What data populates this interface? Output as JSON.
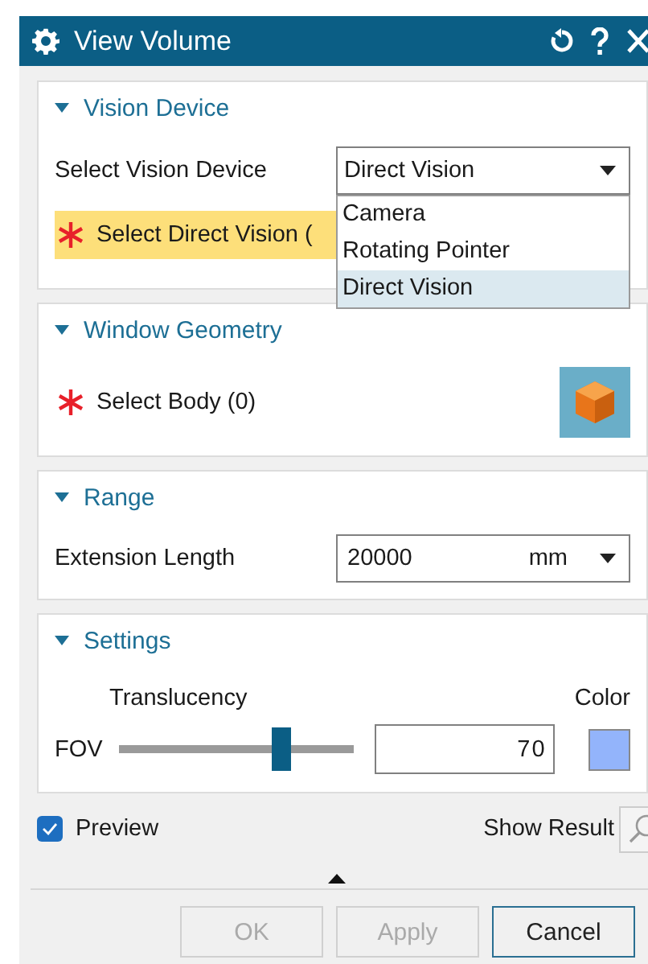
{
  "window": {
    "title": "View Volume"
  },
  "vision_device": {
    "title": "Vision Device",
    "expanded": true,
    "label": "Select Vision Device",
    "value": "Direct Vision",
    "open": true,
    "options": [
      {
        "label": "Camera",
        "selected": false
      },
      {
        "label": "Rotating Pointer",
        "selected": false
      },
      {
        "label": "Direct Vision",
        "selected": true
      }
    ],
    "selection": {
      "label": "Select Direct Vision (",
      "required": true,
      "active": true
    }
  },
  "window_geometry": {
    "title": "Window Geometry",
    "expanded": true,
    "selection": {
      "label": "Select Body (0)",
      "required": true,
      "active": false
    }
  },
  "range": {
    "title": "Range",
    "expanded": true,
    "label": "Extension Length",
    "value": "20000",
    "unit": "mm"
  },
  "settings": {
    "title": "Settings",
    "expanded": true,
    "slider_title": "Translucency",
    "slider_label": "FOV",
    "level": 0.69,
    "value": "70",
    "color_label": "Color",
    "color": "#93b4fb"
  },
  "preview": {
    "label": "Preview",
    "checked": true
  },
  "show_result": {
    "label": "Show Result"
  },
  "buttons": [
    {
      "label": "OK",
      "disabled": true,
      "default": false
    },
    {
      "label": "Apply",
      "disabled": true,
      "default": false
    },
    {
      "label": "Cancel",
      "disabled": false,
      "default": true
    }
  ]
}
